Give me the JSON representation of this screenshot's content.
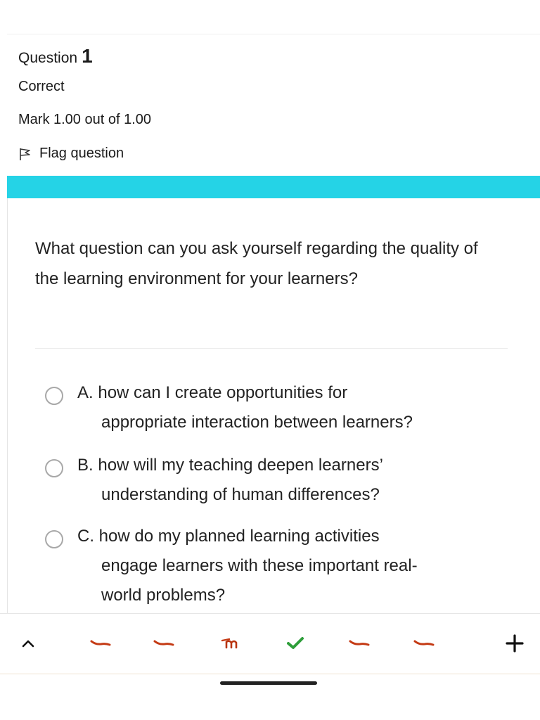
{
  "question": {
    "label": "Question",
    "number": "1",
    "state": "Correct",
    "grade": "Mark 1.00 out of 1.00",
    "flag_label": "Flag question",
    "text": "What question can you ask yourself regarding the quality of the learning environment for your learners?"
  },
  "answers": [
    {
      "letter": "A.",
      "line1": "how can I create opportunities for",
      "rest": [
        "appropriate interaction between learners?"
      ]
    },
    {
      "letter": "B.",
      "line1": "how will my teaching deepen learners’",
      "rest": [
        "understanding of human differences?"
      ]
    },
    {
      "letter": "C.",
      "line1": "how do my planned learning activities",
      "rest": [
        "engage learners with these important real-",
        "world problems?"
      ]
    }
  ],
  "toolbar": {
    "items": [
      {
        "name": "chevron-up-icon",
        "glyph": "^"
      },
      {
        "name": "highlight-icon",
        "glyph": ""
      },
      {
        "name": "highlight-icon",
        "glyph": ""
      },
      {
        "name": "marker-icon",
        "glyph": "m"
      },
      {
        "name": "checkmark-icon",
        "glyph": "✔"
      },
      {
        "name": "highlight-icon",
        "glyph": ""
      },
      {
        "name": "highlight-icon",
        "glyph": ""
      },
      {
        "name": "plus-icon",
        "glyph": "+"
      }
    ]
  },
  "colors": {
    "accent_bar": "#25d3e6",
    "check": "#2e9e3a",
    "highlight": "#c43a14"
  }
}
